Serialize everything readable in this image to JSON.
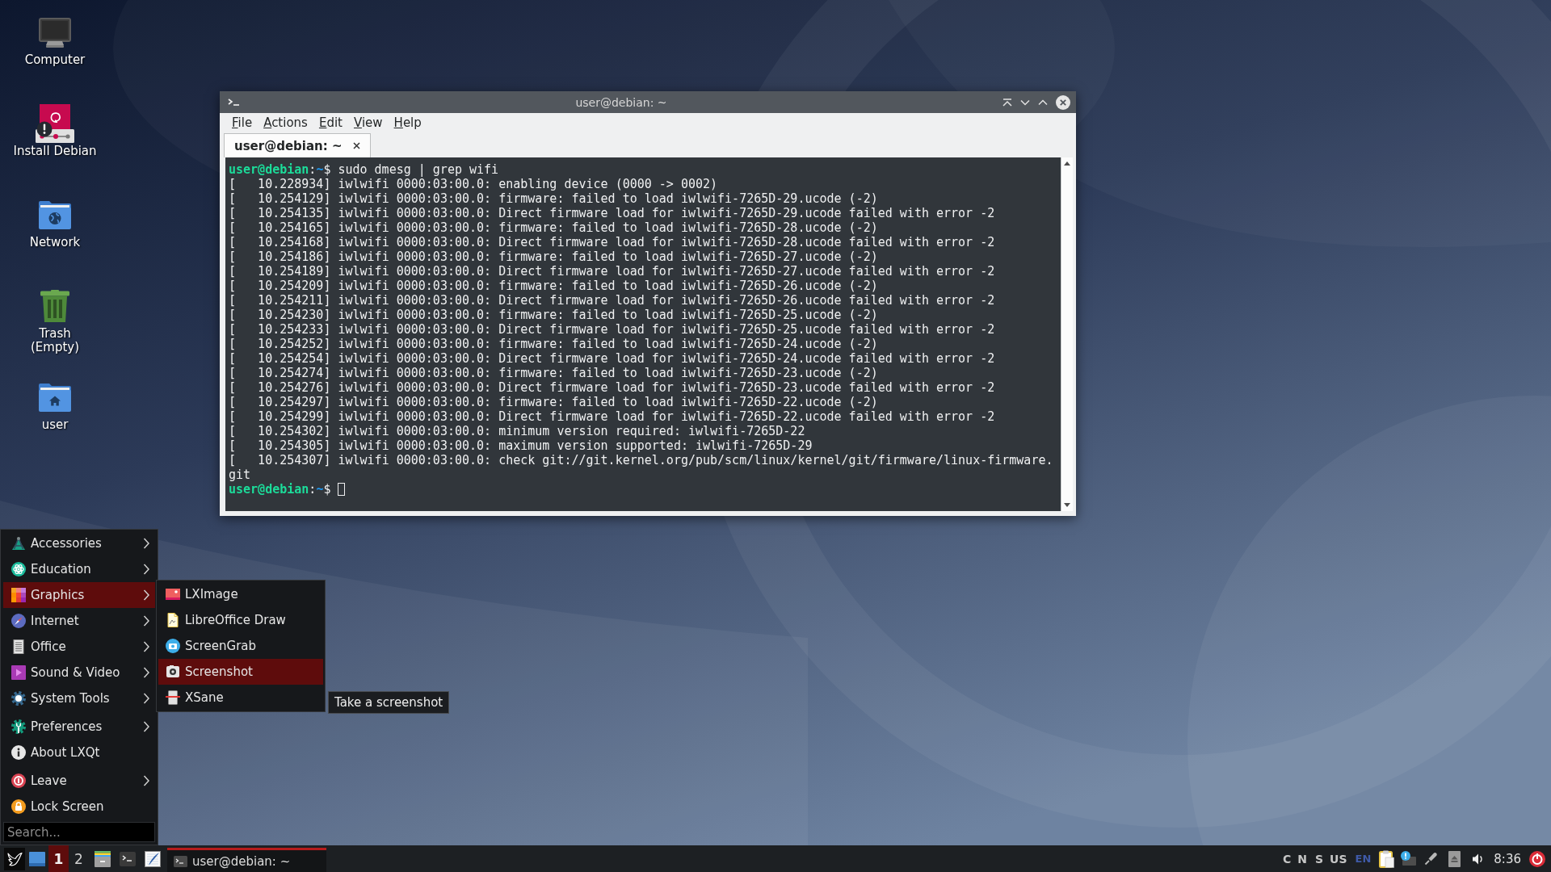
{
  "desktop_icons": [
    {
      "label": "Computer"
    },
    {
      "label": "Install Debian"
    },
    {
      "label": "Network"
    },
    {
      "label": "Trash\n(Empty)"
    },
    {
      "label": "user"
    }
  ],
  "terminal_window": {
    "title": "user@debian: ~",
    "menu": [
      "File",
      "Actions",
      "Edit",
      "View",
      "Help"
    ],
    "tabs": [
      {
        "label": "user@debian: ~",
        "selected": true
      }
    ],
    "lines": [
      {
        "kind": "prompt",
        "user_host": "user@debian",
        "separator": ":",
        "cwd": "~",
        "symbol": "$",
        "command": "sudo dmesg | grep wifi"
      },
      {
        "kind": "output",
        "text": "[   10.228934] iwlwifi 0000:03:00.0: enabling device (0000 -> 0002)"
      },
      {
        "kind": "output",
        "text": "[   10.254129] iwlwifi 0000:03:00.0: firmware: failed to load iwlwifi-7265D-29.ucode (-2)"
      },
      {
        "kind": "output",
        "text": "[   10.254135] iwlwifi 0000:03:00.0: Direct firmware load for iwlwifi-7265D-29.ucode failed with error -2"
      },
      {
        "kind": "output",
        "text": "[   10.254165] iwlwifi 0000:03:00.0: firmware: failed to load iwlwifi-7265D-28.ucode (-2)"
      },
      {
        "kind": "output",
        "text": "[   10.254168] iwlwifi 0000:03:00.0: Direct firmware load for iwlwifi-7265D-28.ucode failed with error -2"
      },
      {
        "kind": "output",
        "text": "[   10.254186] iwlwifi 0000:03:00.0: firmware: failed to load iwlwifi-7265D-27.ucode (-2)"
      },
      {
        "kind": "output",
        "text": "[   10.254189] iwlwifi 0000:03:00.0: Direct firmware load for iwlwifi-7265D-27.ucode failed with error -2"
      },
      {
        "kind": "output",
        "text": "[   10.254209] iwlwifi 0000:03:00.0: firmware: failed to load iwlwifi-7265D-26.ucode (-2)"
      },
      {
        "kind": "output",
        "text": "[   10.254211] iwlwifi 0000:03:00.0: Direct firmware load for iwlwifi-7265D-26.ucode failed with error -2"
      },
      {
        "kind": "output",
        "text": "[   10.254230] iwlwifi 0000:03:00.0: firmware: failed to load iwlwifi-7265D-25.ucode (-2)"
      },
      {
        "kind": "output",
        "text": "[   10.254233] iwlwifi 0000:03:00.0: Direct firmware load for iwlwifi-7265D-25.ucode failed with error -2"
      },
      {
        "kind": "output",
        "text": "[   10.254252] iwlwifi 0000:03:00.0: firmware: failed to load iwlwifi-7265D-24.ucode (-2)"
      },
      {
        "kind": "output",
        "text": "[   10.254254] iwlwifi 0000:03:00.0: Direct firmware load for iwlwifi-7265D-24.ucode failed with error -2"
      },
      {
        "kind": "output",
        "text": "[   10.254274] iwlwifi 0000:03:00.0: firmware: failed to load iwlwifi-7265D-23.ucode (-2)"
      },
      {
        "kind": "output",
        "text": "[   10.254276] iwlwifi 0000:03:00.0: Direct firmware load for iwlwifi-7265D-23.ucode failed with error -2"
      },
      {
        "kind": "output",
        "text": "[   10.254297] iwlwifi 0000:03:00.0: firmware: failed to load iwlwifi-7265D-22.ucode (-2)"
      },
      {
        "kind": "output",
        "text": "[   10.254299] iwlwifi 0000:03:00.0: Direct firmware load for iwlwifi-7265D-22.ucode failed with error -2"
      },
      {
        "kind": "output",
        "text": "[   10.254302] iwlwifi 0000:03:00.0: minimum version required: iwlwifi-7265D-22"
      },
      {
        "kind": "output",
        "text": "[   10.254305] iwlwifi 0000:03:00.0: maximum version supported: iwlwifi-7265D-29"
      },
      {
        "kind": "output",
        "text": "[   10.254307] iwlwifi 0000:03:00.0: check git://git.kernel.org/pub/scm/linux/kernel/git/firmware/linux-firmware."
      },
      {
        "kind": "output",
        "text": "git"
      },
      {
        "kind": "prompt",
        "user_host": "user@debian",
        "separator": ":",
        "cwd": "~",
        "symbol": "$",
        "cursor": true
      }
    ]
  },
  "start_menu": {
    "sections": [
      {
        "items": [
          {
            "label": "Accessories",
            "has_submenu": true,
            "selected": false
          },
          {
            "label": "Education",
            "has_submenu": true,
            "selected": false
          },
          {
            "label": "Graphics",
            "has_submenu": true,
            "selected": true
          },
          {
            "label": "Internet",
            "has_submenu": true,
            "selected": false
          },
          {
            "label": "Office",
            "has_submenu": true,
            "selected": false
          },
          {
            "label": "Sound & Video",
            "has_submenu": true,
            "selected": false
          },
          {
            "label": "System Tools",
            "has_submenu": true,
            "selected": false
          }
        ]
      },
      {
        "items": [
          {
            "label": "Preferences",
            "has_submenu": true,
            "selected": false
          },
          {
            "label": "About LXQt",
            "has_submenu": false,
            "selected": false
          }
        ]
      },
      {
        "items": [
          {
            "label": "Leave",
            "has_submenu": true,
            "selected": false
          },
          {
            "label": "Lock Screen",
            "has_submenu": false,
            "selected": false
          }
        ]
      }
    ],
    "search": {
      "placeholder": "Search..."
    },
    "submenu": {
      "items": [
        {
          "label": "LXImage",
          "selected": false
        },
        {
          "label": "LibreOffice Draw",
          "selected": false
        },
        {
          "label": "ScreenGrab",
          "selected": false
        },
        {
          "label": "Screenshot",
          "selected": true
        },
        {
          "label": "XSane",
          "selected": false
        }
      ],
      "tooltip": "Take a screenshot"
    }
  },
  "taskbar": {
    "desktops": [
      {
        "label": "1",
        "selected": true
      },
      {
        "label": "2",
        "selected": false
      }
    ],
    "tasks": [
      {
        "label": "user@debian: ~",
        "selected": true
      }
    ],
    "keyboard_indicators": [
      "C",
      "N",
      "S",
      "US"
    ],
    "keyboard_layout": "EN",
    "clock": "8:36"
  }
}
